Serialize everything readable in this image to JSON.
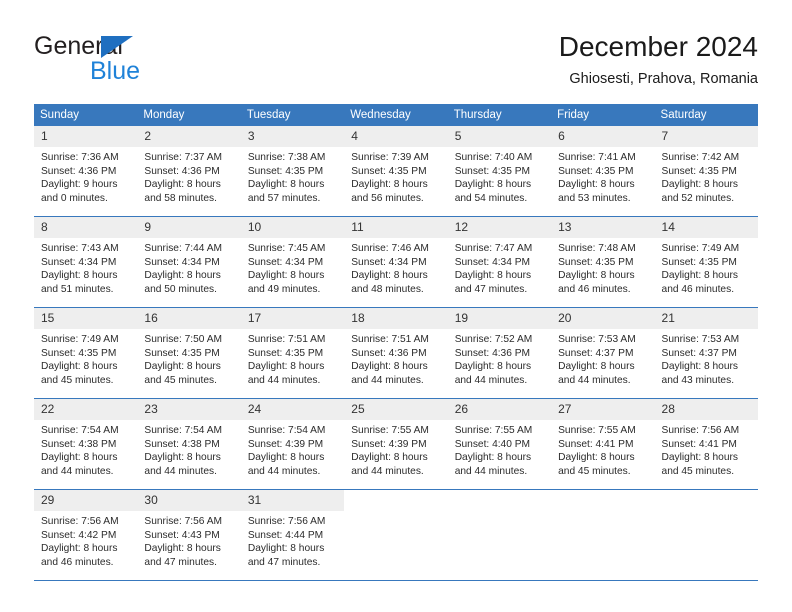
{
  "logo": {
    "word1": "General",
    "word2": "Blue",
    "triangle_color": "#1f6fc0",
    "word2_color": "#1f82d8"
  },
  "header": {
    "title": "December 2024",
    "subtitle": "Ghiosesti, Prahova, Romania"
  },
  "theme": {
    "header_bg": "#3878bd",
    "daynum_bg": "#eeeeee",
    "text": "#2b2b2b"
  },
  "calendar": {
    "weekday_headers": [
      "Sunday",
      "Monday",
      "Tuesday",
      "Wednesday",
      "Thursday",
      "Friday",
      "Saturday"
    ],
    "weeks": [
      [
        {
          "day": "1",
          "sunrise": "Sunrise: 7:36 AM",
          "sunset": "Sunset: 4:36 PM",
          "daylight1": "Daylight: 9 hours",
          "daylight2": "and 0 minutes."
        },
        {
          "day": "2",
          "sunrise": "Sunrise: 7:37 AM",
          "sunset": "Sunset: 4:36 PM",
          "daylight1": "Daylight: 8 hours",
          "daylight2": "and 58 minutes."
        },
        {
          "day": "3",
          "sunrise": "Sunrise: 7:38 AM",
          "sunset": "Sunset: 4:35 PM",
          "daylight1": "Daylight: 8 hours",
          "daylight2": "and 57 minutes."
        },
        {
          "day": "4",
          "sunrise": "Sunrise: 7:39 AM",
          "sunset": "Sunset: 4:35 PM",
          "daylight1": "Daylight: 8 hours",
          "daylight2": "and 56 minutes."
        },
        {
          "day": "5",
          "sunrise": "Sunrise: 7:40 AM",
          "sunset": "Sunset: 4:35 PM",
          "daylight1": "Daylight: 8 hours",
          "daylight2": "and 54 minutes."
        },
        {
          "day": "6",
          "sunrise": "Sunrise: 7:41 AM",
          "sunset": "Sunset: 4:35 PM",
          "daylight1": "Daylight: 8 hours",
          "daylight2": "and 53 minutes."
        },
        {
          "day": "7",
          "sunrise": "Sunrise: 7:42 AM",
          "sunset": "Sunset: 4:35 PM",
          "daylight1": "Daylight: 8 hours",
          "daylight2": "and 52 minutes."
        }
      ],
      [
        {
          "day": "8",
          "sunrise": "Sunrise: 7:43 AM",
          "sunset": "Sunset: 4:34 PM",
          "daylight1": "Daylight: 8 hours",
          "daylight2": "and 51 minutes."
        },
        {
          "day": "9",
          "sunrise": "Sunrise: 7:44 AM",
          "sunset": "Sunset: 4:34 PM",
          "daylight1": "Daylight: 8 hours",
          "daylight2": "and 50 minutes."
        },
        {
          "day": "10",
          "sunrise": "Sunrise: 7:45 AM",
          "sunset": "Sunset: 4:34 PM",
          "daylight1": "Daylight: 8 hours",
          "daylight2": "and 49 minutes."
        },
        {
          "day": "11",
          "sunrise": "Sunrise: 7:46 AM",
          "sunset": "Sunset: 4:34 PM",
          "daylight1": "Daylight: 8 hours",
          "daylight2": "and 48 minutes."
        },
        {
          "day": "12",
          "sunrise": "Sunrise: 7:47 AM",
          "sunset": "Sunset: 4:34 PM",
          "daylight1": "Daylight: 8 hours",
          "daylight2": "and 47 minutes."
        },
        {
          "day": "13",
          "sunrise": "Sunrise: 7:48 AM",
          "sunset": "Sunset: 4:35 PM",
          "daylight1": "Daylight: 8 hours",
          "daylight2": "and 46 minutes."
        },
        {
          "day": "14",
          "sunrise": "Sunrise: 7:49 AM",
          "sunset": "Sunset: 4:35 PM",
          "daylight1": "Daylight: 8 hours",
          "daylight2": "and 46 minutes."
        }
      ],
      [
        {
          "day": "15",
          "sunrise": "Sunrise: 7:49 AM",
          "sunset": "Sunset: 4:35 PM",
          "daylight1": "Daylight: 8 hours",
          "daylight2": "and 45 minutes."
        },
        {
          "day": "16",
          "sunrise": "Sunrise: 7:50 AM",
          "sunset": "Sunset: 4:35 PM",
          "daylight1": "Daylight: 8 hours",
          "daylight2": "and 45 minutes."
        },
        {
          "day": "17",
          "sunrise": "Sunrise: 7:51 AM",
          "sunset": "Sunset: 4:35 PM",
          "daylight1": "Daylight: 8 hours",
          "daylight2": "and 44 minutes."
        },
        {
          "day": "18",
          "sunrise": "Sunrise: 7:51 AM",
          "sunset": "Sunset: 4:36 PM",
          "daylight1": "Daylight: 8 hours",
          "daylight2": "and 44 minutes."
        },
        {
          "day": "19",
          "sunrise": "Sunrise: 7:52 AM",
          "sunset": "Sunset: 4:36 PM",
          "daylight1": "Daylight: 8 hours",
          "daylight2": "and 44 minutes."
        },
        {
          "day": "20",
          "sunrise": "Sunrise: 7:53 AM",
          "sunset": "Sunset: 4:37 PM",
          "daylight1": "Daylight: 8 hours",
          "daylight2": "and 44 minutes."
        },
        {
          "day": "21",
          "sunrise": "Sunrise: 7:53 AM",
          "sunset": "Sunset: 4:37 PM",
          "daylight1": "Daylight: 8 hours",
          "daylight2": "and 43 minutes."
        }
      ],
      [
        {
          "day": "22",
          "sunrise": "Sunrise: 7:54 AM",
          "sunset": "Sunset: 4:38 PM",
          "daylight1": "Daylight: 8 hours",
          "daylight2": "and 44 minutes."
        },
        {
          "day": "23",
          "sunrise": "Sunrise: 7:54 AM",
          "sunset": "Sunset: 4:38 PM",
          "daylight1": "Daylight: 8 hours",
          "daylight2": "and 44 minutes."
        },
        {
          "day": "24",
          "sunrise": "Sunrise: 7:54 AM",
          "sunset": "Sunset: 4:39 PM",
          "daylight1": "Daylight: 8 hours",
          "daylight2": "and 44 minutes."
        },
        {
          "day": "25",
          "sunrise": "Sunrise: 7:55 AM",
          "sunset": "Sunset: 4:39 PM",
          "daylight1": "Daylight: 8 hours",
          "daylight2": "and 44 minutes."
        },
        {
          "day": "26",
          "sunrise": "Sunrise: 7:55 AM",
          "sunset": "Sunset: 4:40 PM",
          "daylight1": "Daylight: 8 hours",
          "daylight2": "and 44 minutes."
        },
        {
          "day": "27",
          "sunrise": "Sunrise: 7:55 AM",
          "sunset": "Sunset: 4:41 PM",
          "daylight1": "Daylight: 8 hours",
          "daylight2": "and 45 minutes."
        },
        {
          "day": "28",
          "sunrise": "Sunrise: 7:56 AM",
          "sunset": "Sunset: 4:41 PM",
          "daylight1": "Daylight: 8 hours",
          "daylight2": "and 45 minutes."
        }
      ],
      [
        {
          "day": "29",
          "sunrise": "Sunrise: 7:56 AM",
          "sunset": "Sunset: 4:42 PM",
          "daylight1": "Daylight: 8 hours",
          "daylight2": "and 46 minutes."
        },
        {
          "day": "30",
          "sunrise": "Sunrise: 7:56 AM",
          "sunset": "Sunset: 4:43 PM",
          "daylight1": "Daylight: 8 hours",
          "daylight2": "and 47 minutes."
        },
        {
          "day": "31",
          "sunrise": "Sunrise: 7:56 AM",
          "sunset": "Sunset: 4:44 PM",
          "daylight1": "Daylight: 8 hours",
          "daylight2": "and 47 minutes."
        },
        {
          "day": "",
          "sunrise": "",
          "sunset": "",
          "daylight1": "",
          "daylight2": ""
        },
        {
          "day": "",
          "sunrise": "",
          "sunset": "",
          "daylight1": "",
          "daylight2": ""
        },
        {
          "day": "",
          "sunrise": "",
          "sunset": "",
          "daylight1": "",
          "daylight2": ""
        },
        {
          "day": "",
          "sunrise": "",
          "sunset": "",
          "daylight1": "",
          "daylight2": ""
        }
      ]
    ]
  }
}
